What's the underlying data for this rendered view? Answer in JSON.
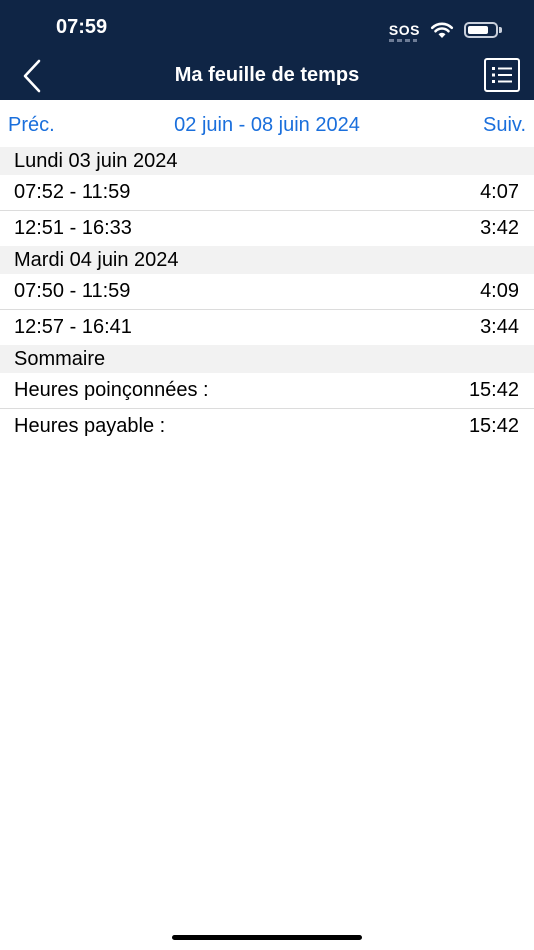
{
  "status_bar": {
    "time": "07:59",
    "sos": "SOS",
    "wifi_icon": "wifi-icon",
    "battery_level": 0.75
  },
  "nav": {
    "title": "Ma feuille de temps",
    "back_icon": "chevron-left-icon",
    "list_icon": "list-icon"
  },
  "week": {
    "prev": "Préc.",
    "range": "02 juin - 08 juin 2024",
    "next": "Suiv."
  },
  "days": [
    {
      "label": "Lundi 03 juin 2024",
      "entries": [
        {
          "range": "07:52 - 11:59",
          "duration": "4:07"
        },
        {
          "range": "12:51 - 16:33",
          "duration": "3:42"
        }
      ]
    },
    {
      "label": "Mardi 04 juin 2024",
      "entries": [
        {
          "range": "07:50 - 11:59",
          "duration": "4:09"
        },
        {
          "range": "12:57 - 16:41",
          "duration": "3:44"
        }
      ]
    }
  ],
  "summary": {
    "label": "Sommaire",
    "punched_label": "Heures poinçonnées :",
    "punched_value": "15:42",
    "payable_label": "Heures payable :",
    "payable_value": "15:42"
  },
  "colors": {
    "nav_bg": "#0f2545",
    "link": "#1a6fdc",
    "section_bg": "#f2f2f2"
  }
}
